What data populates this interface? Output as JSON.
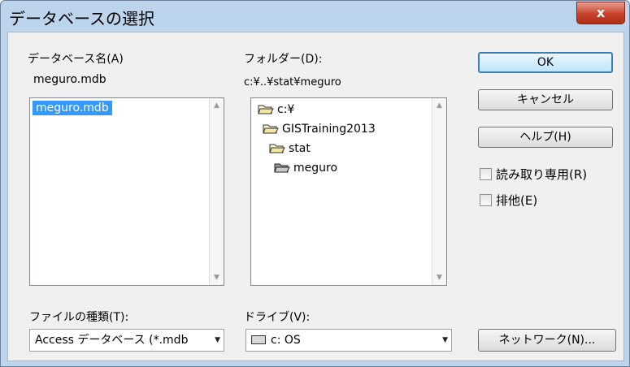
{
  "window": {
    "title": "データベースの選択",
    "close_glyph": "x"
  },
  "db_name": {
    "label": "データベース名(A)",
    "value": "meguro.mdb",
    "files": [
      "meguro.mdb"
    ]
  },
  "folder": {
    "label": "フォルダー(D):",
    "path": "c:¥..¥stat¥meguro",
    "tree": [
      "c:¥",
      "GISTraining2013",
      "stat",
      "meguro"
    ]
  },
  "buttons": {
    "ok": "OK",
    "cancel": "キャンセル",
    "help": "ヘルプ(H)",
    "network": "ネットワーク(N)..."
  },
  "options": {
    "readonly": "読み取り専用(R)",
    "exclusive": "排他(E)"
  },
  "file_type": {
    "label": "ファイルの種類(T):",
    "value": "Access データベース (*.mdb"
  },
  "drive": {
    "label": "ドライブ(V):",
    "value": "c: OS"
  },
  "colors": {
    "title_bg": "#bcd4ec",
    "selection": "#3399ff",
    "close": "#c8412a"
  }
}
